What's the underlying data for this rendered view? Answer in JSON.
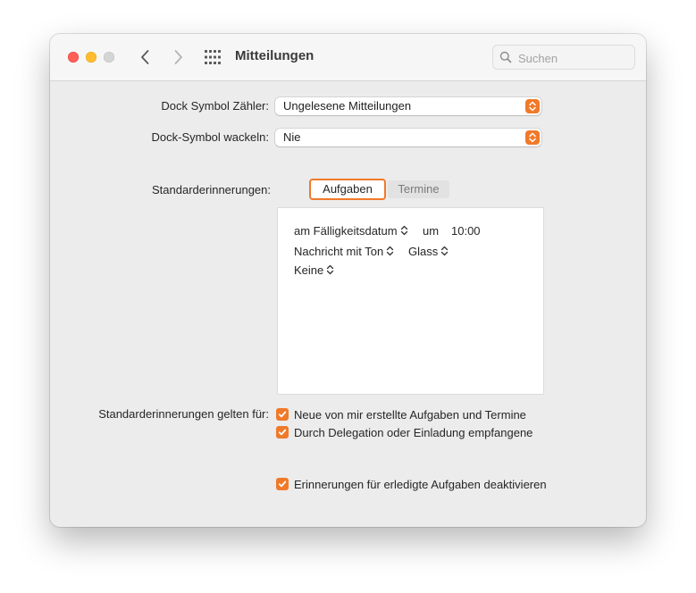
{
  "window": {
    "title": "Mitteilungen",
    "search_placeholder": "Suchen",
    "traffic_lights": [
      "close",
      "minimize",
      "zoom"
    ]
  },
  "accent_color": "#f07a2a",
  "settings": {
    "dock_badge": {
      "label": "Dock Symbol Zähler:",
      "value": "Ungelesene Mitteilungen"
    },
    "dock_bounce": {
      "label": "Dock-Symbol wackeln:",
      "value": "Nie"
    },
    "default_reminders": {
      "label": "Standarderinnerungen:",
      "tabs": [
        {
          "label": "Aufgaben",
          "selected": true
        },
        {
          "label": "Termine",
          "selected": false
        }
      ],
      "panel": {
        "when_value": "am Fälligkeitsdatum",
        "at_label": "um",
        "time_value": "10:00",
        "alert_type": "Nachricht mit Ton",
        "sound": "Glass",
        "second_alert": "Keine"
      }
    },
    "apply_to": {
      "label": "Standarderinnerungen gelten für:",
      "options": [
        {
          "label": "Neue von mir erstellte Aufgaben und Termine",
          "checked": true
        },
        {
          "label": "Durch Delegation oder Einladung empfangene",
          "checked": true
        }
      ]
    },
    "disable_completed": {
      "label": "Erinnerungen für erledigte Aufgaben deaktivieren",
      "checked": true
    }
  }
}
